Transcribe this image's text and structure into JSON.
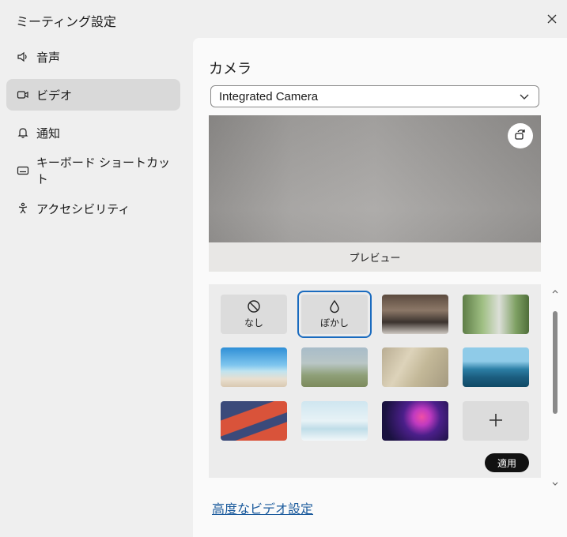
{
  "window": {
    "title": "ミーティング設定",
    "close_icon": "close-icon"
  },
  "sidebar": {
    "items": [
      {
        "label": "音声",
        "icon": "speaker-icon"
      },
      {
        "label": "ビデオ",
        "icon": "video-camera-icon",
        "active": true
      },
      {
        "label": "通知",
        "icon": "bell-icon"
      },
      {
        "label": "キーボード ショートカット",
        "icon": "keyboard-icon"
      },
      {
        "label": "アクセシビリティ",
        "icon": "accessibility-icon"
      }
    ]
  },
  "camera": {
    "heading": "カメラ",
    "device_selected": "Integrated Camera",
    "preview_label": "プレビュー"
  },
  "backgrounds": {
    "none_label": "なし",
    "blur_label": "ぼかし",
    "selected": "ぼかし",
    "apply_label": "適用",
    "add_icon": "plus-icon"
  },
  "advanced_link": "高度なビデオ設定",
  "colors": {
    "accent": "#1a6bbf",
    "link": "#1a5a9c",
    "active_nav": "#d9d9d9"
  }
}
